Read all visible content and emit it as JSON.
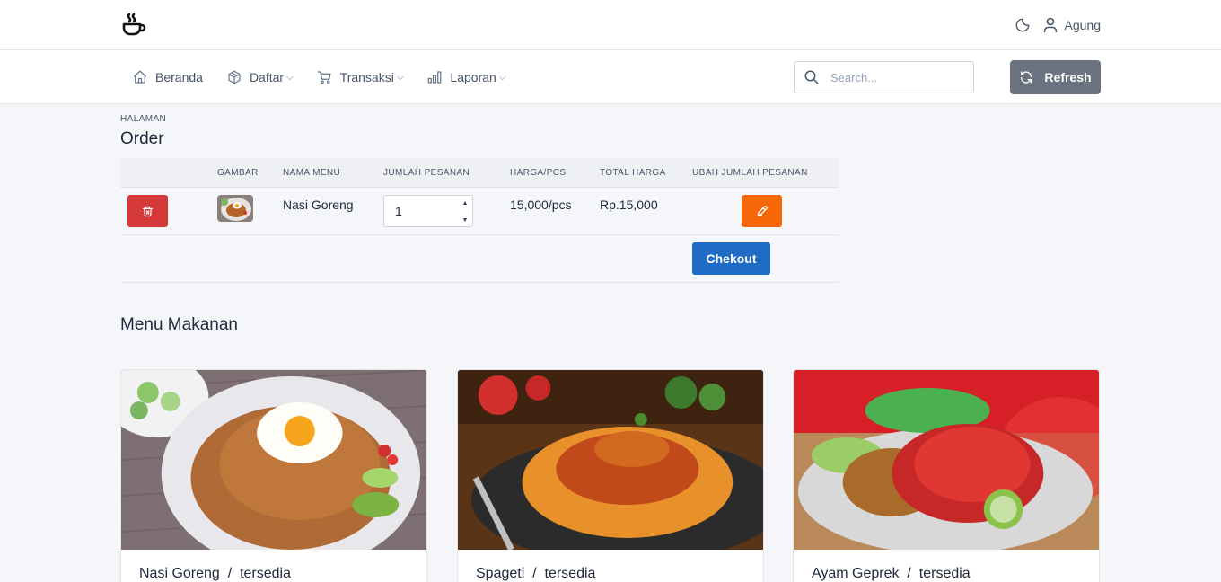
{
  "header": {
    "user_name": "Agung"
  },
  "nav": {
    "items": [
      {
        "label": "Beranda",
        "icon": "home-icon"
      },
      {
        "label": "Daftar",
        "icon": "package-icon",
        "dropdown": true
      },
      {
        "label": "Transaksi",
        "icon": "cart-icon",
        "dropdown": true
      },
      {
        "label": "Laporan",
        "icon": "chart-icon",
        "dropdown": true
      }
    ],
    "search_placeholder": "Search...",
    "refresh_label": "Refresh"
  },
  "page": {
    "overline": "HALAMAN",
    "title": "Order"
  },
  "order_table": {
    "headers": [
      "GAMBAR",
      "NAMA MENU",
      "JUMLAH PESANAN",
      "HARGA/PCS",
      "TOTAL HARGA",
      "UBAH JUMLAH PESANAN"
    ],
    "rows": [
      {
        "name": "Nasi Goreng",
        "qty": "1",
        "price": "15,000/pcs",
        "total": "Rp.15,000"
      }
    ],
    "checkout_label": "Chekout"
  },
  "menu": {
    "title": "Menu Makanan",
    "cards": [
      {
        "name": "Nasi Goreng",
        "status": "tersedia"
      },
      {
        "name": "Spageti",
        "status": "tersedia"
      },
      {
        "name": "Ayam Geprek",
        "status": "tersedia"
      }
    ]
  },
  "colors": {
    "danger": "#d63939",
    "warning": "#f76707",
    "primary": "#206bc4",
    "secondary": "#6b7280"
  }
}
